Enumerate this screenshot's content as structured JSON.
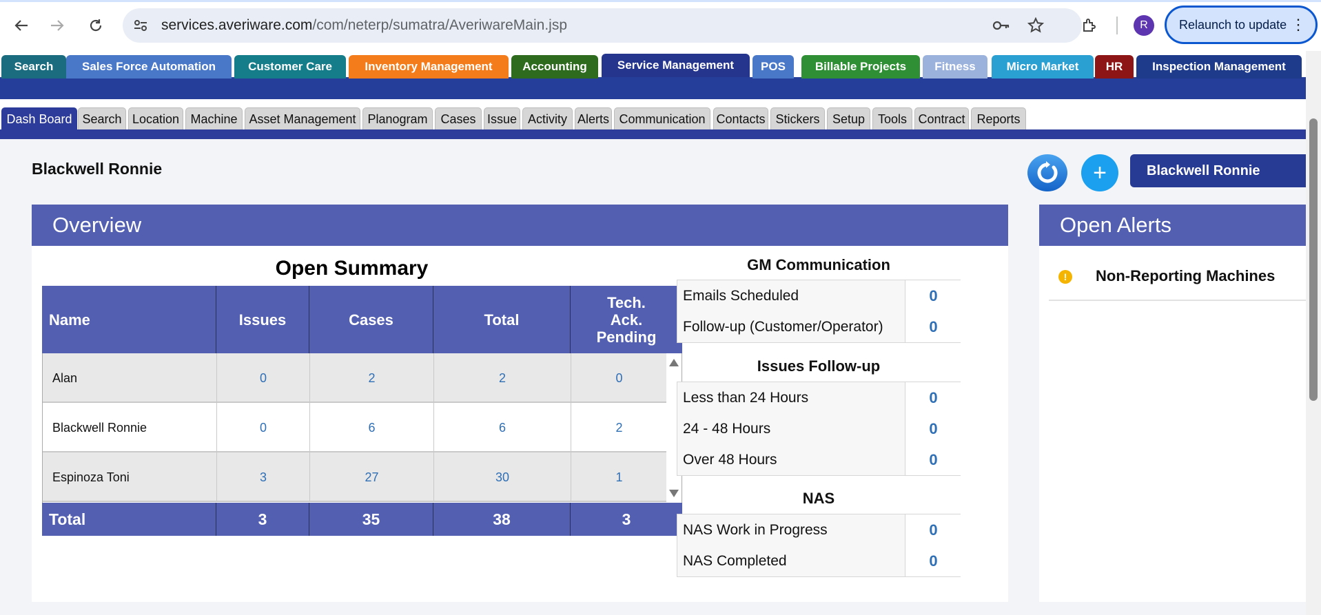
{
  "browser": {
    "url_host": "services.averiware.com",
    "url_path": "/com/neterp/sumatra/AveriwareMain.jsp",
    "profile_initial": "R",
    "relaunch_label": "Relaunch to update"
  },
  "modules": [
    {
      "label": "Search",
      "color": "#1b6c7e"
    },
    {
      "label": "Sales Force Automation",
      "color": "#4a78c8"
    },
    {
      "label": "Customer Care",
      "color": "#157c89"
    },
    {
      "label": "Inventory Management",
      "color": "#f47c1a"
    },
    {
      "label": "Accounting",
      "color": "#2e6b1f"
    },
    {
      "label": "Service Management",
      "color": "#25348d"
    },
    {
      "label": "POS",
      "color": "#4a78c8"
    },
    {
      "label": "Billable Projects",
      "color": "#2f8f34"
    },
    {
      "label": "Fitness",
      "color": "#9bb2dc"
    },
    {
      "label": "Micro Market",
      "color": "#2a9fd2"
    },
    {
      "label": "HR",
      "color": "#8d1515"
    },
    {
      "label": "Inspection Management",
      "color": "#1e3a8a"
    }
  ],
  "subtabs": [
    "Dash Board",
    "Search",
    "Location",
    "Machine",
    "Asset Management",
    "Planogram",
    "Cases",
    "Issue",
    "Activity",
    "Alerts",
    "Communication",
    "Contacts",
    "Stickers",
    "Setup",
    "Tools",
    "Contract",
    "Reports"
  ],
  "user": {
    "name": "Blackwell Ronnie",
    "button_label": "Blackwell Ronnie",
    "add_symbol": "+"
  },
  "overview": {
    "title": "Overview",
    "summary_title": "Open Summary",
    "columns": [
      "Name",
      "Issues",
      "Cases",
      "Total",
      "Tech. Ack. Pending"
    ],
    "rows": [
      [
        "Alan",
        "0",
        "2",
        "2",
        "0"
      ],
      [
        "Blackwell Ronnie",
        "0",
        "6",
        "6",
        "2"
      ],
      [
        "Espinoza Toni",
        "3",
        "27",
        "30",
        "1"
      ]
    ],
    "totals": [
      "Total",
      "3",
      "35",
      "38",
      "3"
    ]
  },
  "gm_communication": {
    "title": "GM Communication",
    "rows": [
      {
        "label": "Emails Scheduled",
        "value": "0"
      },
      {
        "label": "Follow-up (Customer/Operator)",
        "value": "0"
      }
    ]
  },
  "issues_followup": {
    "title": "Issues Follow-up",
    "rows": [
      {
        "label": "Less than 24 Hours",
        "value": "0"
      },
      {
        "label": "24 - 48 Hours",
        "value": "0"
      },
      {
        "label": "Over 48 Hours",
        "value": "0"
      }
    ]
  },
  "nas": {
    "title": "NAS",
    "rows": [
      {
        "label": "NAS Work in Progress",
        "value": "0"
      },
      {
        "label": "NAS Completed",
        "value": "0"
      }
    ]
  },
  "alerts": {
    "title": "Open Alerts",
    "items": [
      {
        "label": "Non-Reporting Machines",
        "icon": "warning-icon"
      }
    ]
  }
}
